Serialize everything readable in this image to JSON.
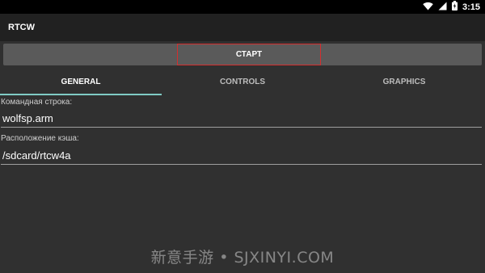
{
  "status_bar": {
    "time": "3:15",
    "icons": [
      "wifi-icon",
      "signal-icon",
      "battery-icon"
    ]
  },
  "app_bar": {
    "title": "RTCW"
  },
  "start_button": {
    "label": "СТАРТ"
  },
  "tabs": [
    {
      "label": "GENERAL",
      "active": true
    },
    {
      "label": "CONTROLS",
      "active": false
    },
    {
      "label": "GRAPHICS",
      "active": false
    }
  ],
  "fields": {
    "command_line": {
      "label": "Командная строка:",
      "value": "wolfsp.arm"
    },
    "cache_location": {
      "label": "Расположение кэша:",
      "value": "/sdcard/rtcw4a"
    }
  },
  "watermark": {
    "text": "新意手游 • SJXINYI.COM"
  },
  "colors": {
    "background": "#303030",
    "app_bar": "#212121",
    "status_bar": "#000000",
    "start_bar": "#5a5a5a",
    "start_button_border": "#d32f2f",
    "tab_indicator": "#80cbc4"
  }
}
